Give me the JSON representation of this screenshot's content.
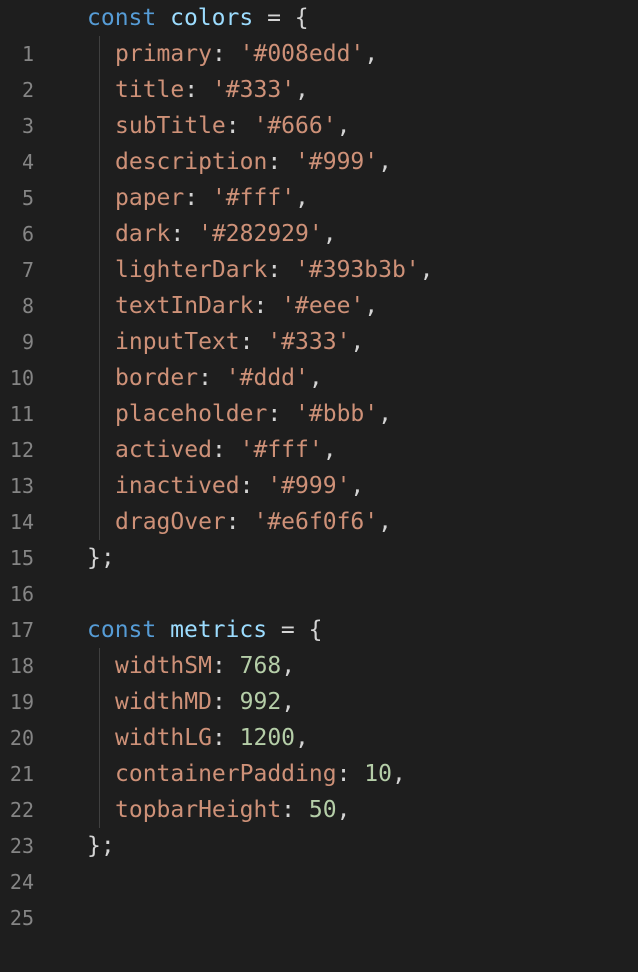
{
  "gutter": {
    "line_numbers": [
      "1",
      "2",
      "3",
      "4",
      "5",
      "6",
      "7",
      "8",
      "9",
      "10",
      "11",
      "12",
      "13",
      "14",
      "15",
      "16",
      "17",
      "18",
      "19",
      "20",
      "21",
      "22",
      "23",
      "24",
      "25"
    ]
  },
  "code": {
    "colors_block": {
      "keyword": "const",
      "name": "colors",
      "equals": "=",
      "open": "{",
      "close": "};",
      "props": [
        {
          "key": "primary",
          "value": "'#008edd'"
        },
        {
          "key": "title",
          "value": "'#333'"
        },
        {
          "key": "subTitle",
          "value": "'#666'"
        },
        {
          "key": "description",
          "value": "'#999'"
        },
        {
          "key": "paper",
          "value": "'#fff'"
        },
        {
          "key": "dark",
          "value": "'#282929'"
        },
        {
          "key": "lighterDark",
          "value": "'#393b3b'"
        },
        {
          "key": "textInDark",
          "value": "'#eee'"
        },
        {
          "key": "inputText",
          "value": "'#333'"
        },
        {
          "key": "border",
          "value": "'#ddd'"
        },
        {
          "key": "placeholder",
          "value": "'#bbb'"
        },
        {
          "key": "actived",
          "value": "'#fff'"
        },
        {
          "key": "inactived",
          "value": "'#999'"
        },
        {
          "key": "dragOver",
          "value": "'#e6f0f6'"
        }
      ]
    },
    "metrics_block": {
      "keyword": "const",
      "name": "metrics",
      "equals": "=",
      "open": "{",
      "close": "};",
      "props": [
        {
          "key": "widthSM",
          "value": "768"
        },
        {
          "key": "widthMD",
          "value": "992"
        },
        {
          "key": "widthLG",
          "value": "1200"
        },
        {
          "key": "containerPadding",
          "value": "10"
        },
        {
          "key": "topbarHeight",
          "value": "50"
        }
      ]
    },
    "punct": {
      "colon": ": ",
      "comma": ","
    }
  },
  "theme": {
    "background": "#1e1e1e",
    "keyword": "#569cd6",
    "identifier": "#9cdcfe",
    "string": "#ce9178",
    "number": "#b5cea8",
    "line_number": "#858585"
  }
}
